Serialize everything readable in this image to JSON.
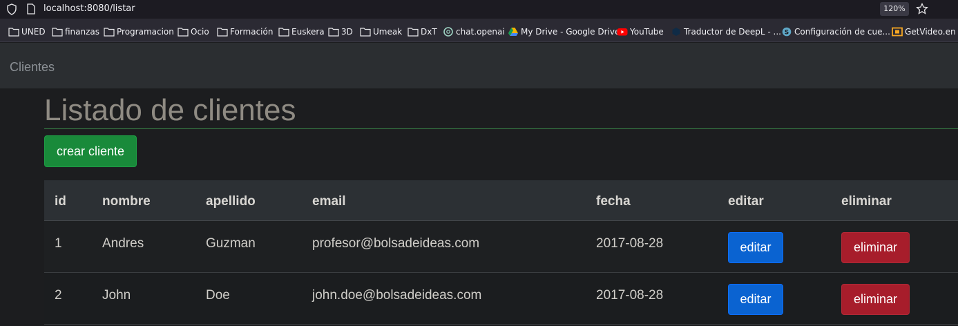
{
  "browser": {
    "url": "localhost:8080/listar",
    "zoom": "120%",
    "bookmarks": [
      {
        "label": "UNED",
        "icon": "folder-icon"
      },
      {
        "label": "finanzas",
        "icon": "folder-icon"
      },
      {
        "label": "Programacion",
        "icon": "folder-icon"
      },
      {
        "label": "Ocio",
        "icon": "folder-icon"
      },
      {
        "label": "Formación",
        "icon": "folder-icon"
      },
      {
        "label": "Euskera",
        "icon": "folder-icon"
      },
      {
        "label": "3D",
        "icon": "folder-icon"
      },
      {
        "label": "Umeak",
        "icon": "folder-icon"
      },
      {
        "label": "DxT",
        "icon": "folder-icon"
      },
      {
        "label": "chat.openai",
        "icon": "openai-icon"
      },
      {
        "label": "My Drive - Google Drive",
        "icon": "google-drive-icon"
      },
      {
        "label": "YouTube",
        "icon": "youtube-icon"
      },
      {
        "label": "Traductor de DeepL - ...",
        "icon": "deepl-icon"
      },
      {
        "label": "Configuración de cue...",
        "icon": "settings-site-icon"
      },
      {
        "label": "GetVideo.en | D",
        "icon": "getvideo-icon"
      }
    ]
  },
  "navbar": {
    "brand": "Clientes"
  },
  "page": {
    "title": "Listado de clientes",
    "create_button": "crear cliente"
  },
  "table": {
    "headers": {
      "id": "id",
      "nombre": "nombre",
      "apellido": "apellido",
      "email": "email",
      "fecha": "fecha",
      "editar": "editar",
      "eliminar": "eliminar"
    },
    "rows": [
      {
        "id": "1",
        "nombre": "Andres",
        "apellido": "Guzman",
        "email": "profesor@bolsadeideas.com",
        "fecha": "2017-08-28",
        "edit_label": "editar",
        "delete_label": "eliminar"
      },
      {
        "id": "2",
        "nombre": "John",
        "apellido": "Doe",
        "email": "john.doe@bolsadeideas.com",
        "fecha": "2017-08-28",
        "edit_label": "editar",
        "delete_label": "eliminar"
      }
    ]
  },
  "colors": {
    "create": "#198a3a",
    "edit": "#0a63d1",
    "delete": "#a71d2b"
  }
}
